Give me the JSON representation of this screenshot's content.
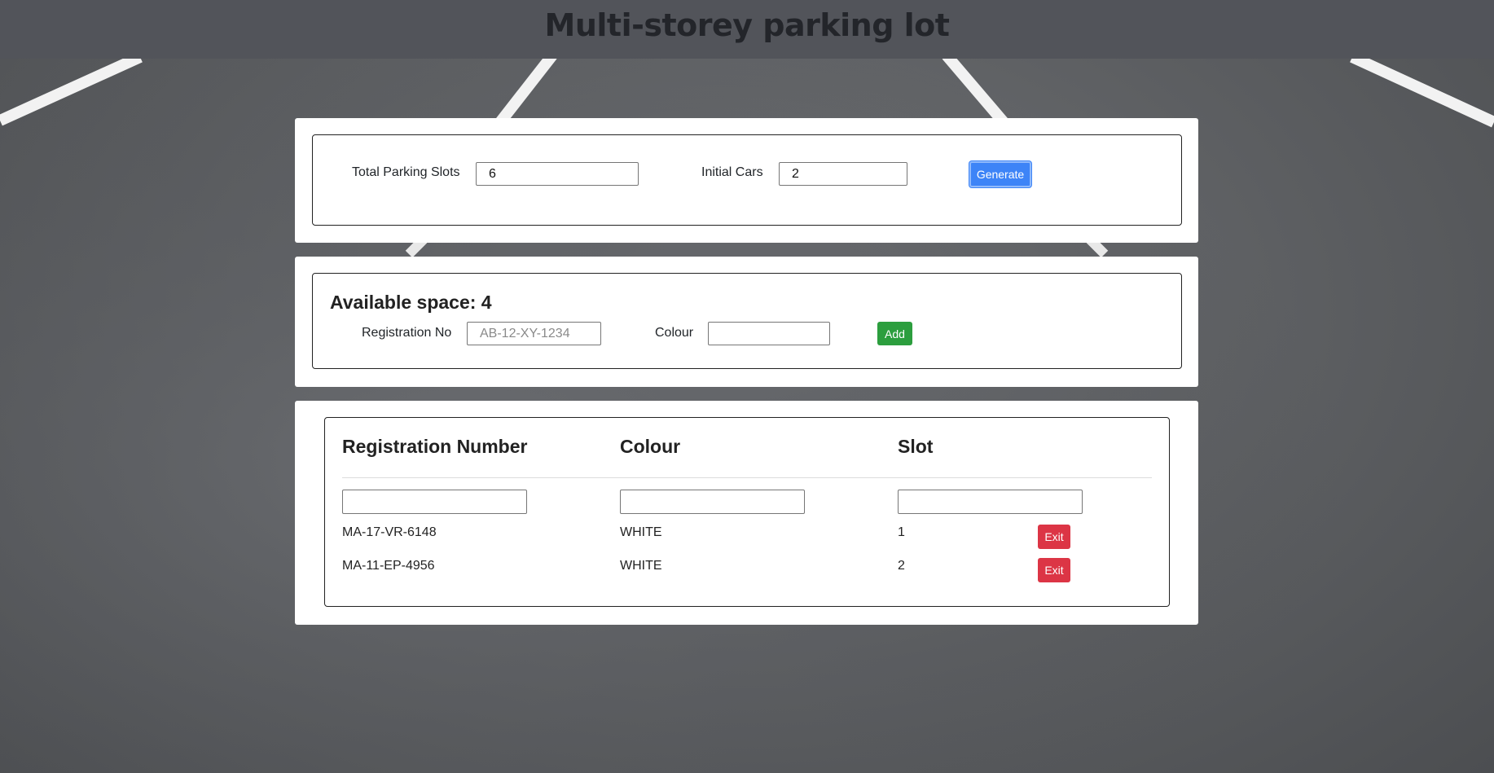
{
  "app": {
    "title": "Multi-storey parking lot"
  },
  "setup": {
    "total_slots_label": "Total Parking Slots",
    "total_slots_value": "6",
    "initial_cars_label": "Initial Cars",
    "initial_cars_value": "2",
    "generate_label": "Generate"
  },
  "add_car": {
    "available_label": "Available space: 4",
    "registration_label": "Registration No",
    "registration_placeholder": "AB-12-XY-1234",
    "registration_value": "",
    "colour_label": "Colour",
    "colour_value": "",
    "add_label": "Add"
  },
  "table": {
    "headers": [
      "Registration Number",
      "Colour",
      "Slot"
    ],
    "filters": [
      "",
      "",
      ""
    ],
    "rows": [
      {
        "registration": "MA-17-VR-6148",
        "colour": "WHITE",
        "slot": "1",
        "action": "Exit"
      },
      {
        "registration": "MA-11-EP-4956",
        "colour": "WHITE",
        "slot": "2",
        "action": "Exit"
      }
    ]
  },
  "colors": {
    "header_bg": "#52545a",
    "primary": "#3d84f7",
    "success": "#2c9e3e",
    "danger": "#dc3545"
  }
}
